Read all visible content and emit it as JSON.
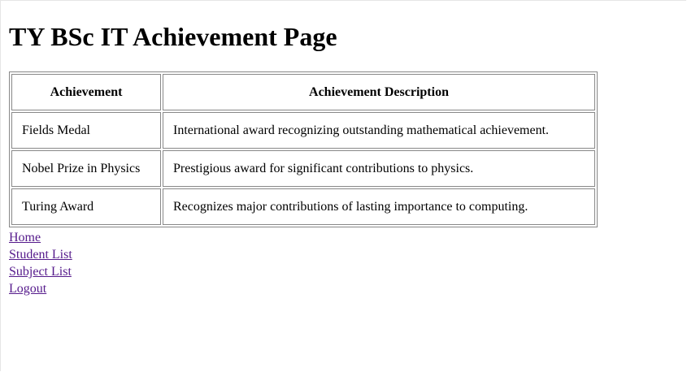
{
  "page": {
    "title": "TY BSc IT Achievement Page"
  },
  "table": {
    "headers": [
      "Achievement",
      "Achievement Description"
    ],
    "rows": [
      [
        "Fields Medal",
        "International award recognizing outstanding mathematical achievement."
      ],
      [
        "Nobel Prize in Physics",
        "Prestigious award for significant contributions to physics."
      ],
      [
        "Turing Award",
        "Recognizes major contributions of lasting importance to computing."
      ]
    ]
  },
  "nav": {
    "links": [
      "Home",
      "Student List",
      "Subject List",
      "Logout"
    ]
  },
  "colors": {
    "link": "#551a8b",
    "border": "#888888",
    "background": "#ffffff"
  }
}
